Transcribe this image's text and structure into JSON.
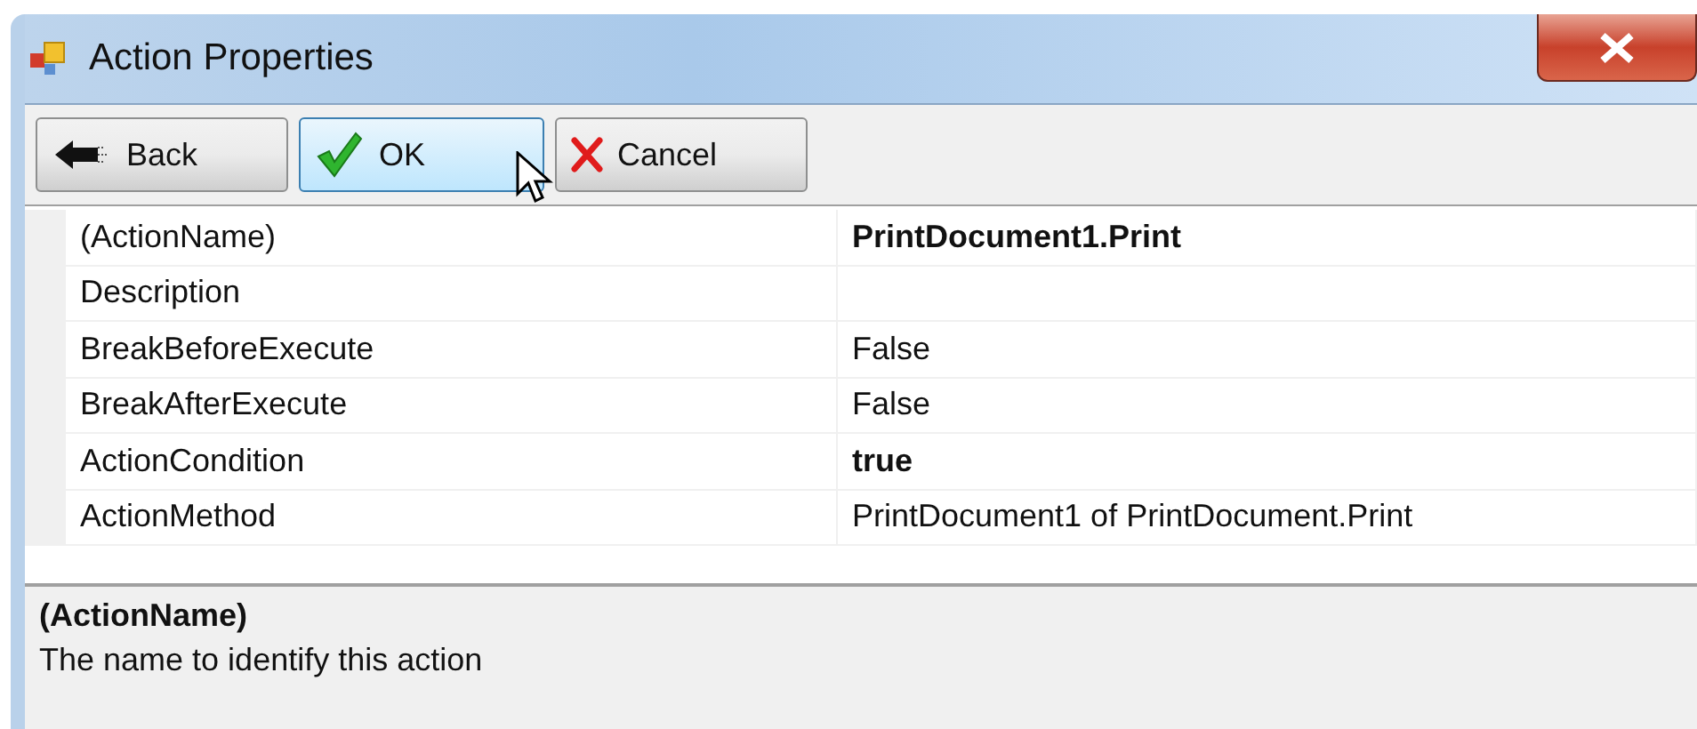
{
  "window": {
    "title": "Action Properties"
  },
  "toolbar": [
    {
      "label": "Back",
      "hovered": false
    },
    {
      "label": "OK",
      "hovered": true
    },
    {
      "label": "Cancel",
      "hovered": false
    }
  ],
  "properties": [
    {
      "name": "(ActionName)",
      "value": "PrintDocument1.Print",
      "modified": true,
      "selected": false
    },
    {
      "name": "Description",
      "selected": false
    },
    {
      "name": "BreakBeforeExecute",
      "value": "False",
      "modified": false,
      "selected": false
    },
    {
      "name": "BreakAfterExecute",
      "value": "False",
      "modified": false,
      "selected": false
    },
    {
      "name": "ActionCondition",
      "value": "true",
      "modified": true,
      "selected": false
    },
    {
      "name": "ActionMethod",
      "value": "PrintDocument1 of PrintDocument.Print",
      "modified": false,
      "selected": false
    }
  ],
  "help": {
    "title": "(ActionName)",
    "text": "The name to identify this action"
  }
}
